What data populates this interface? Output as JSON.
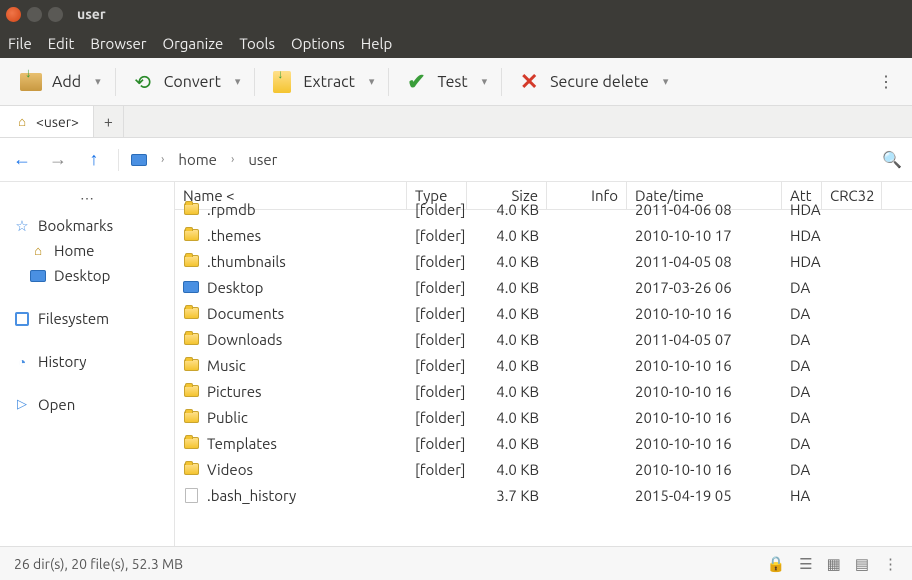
{
  "titlebar": {
    "title": "user"
  },
  "menubar": [
    "File",
    "Edit",
    "Browser",
    "Organize",
    "Tools",
    "Options",
    "Help"
  ],
  "toolbar": {
    "add": "Add",
    "convert": "Convert",
    "extract": "Extract",
    "test": "Test",
    "secure_delete": "Secure delete"
  },
  "tab": {
    "label": "<user>"
  },
  "breadcrumb": [
    "home",
    "user"
  ],
  "sidebar": {
    "bookmarks": "Bookmarks",
    "home": "Home",
    "desktop": "Desktop",
    "filesystem": "Filesystem",
    "history": "History",
    "open": "Open"
  },
  "columns": {
    "name": "Name <",
    "type": "Type",
    "size": "Size",
    "info": "Info",
    "date": "Date/time",
    "attr": "Att",
    "crc": "CRC32"
  },
  "files": [
    {
      "icon": "folder",
      "name": ".rpmdb",
      "type": "[folder]",
      "size": "4.0 KB",
      "date": "2011-04-06 08",
      "attr": "HDA"
    },
    {
      "icon": "folder",
      "name": ".themes",
      "type": "[folder]",
      "size": "4.0 KB",
      "date": "2010-10-10 17",
      "attr": "HDA"
    },
    {
      "icon": "folder",
      "name": ".thumbnails",
      "type": "[folder]",
      "size": "4.0 KB",
      "date": "2011-04-05 08",
      "attr": "HDA"
    },
    {
      "icon": "desktop",
      "name": "Desktop",
      "type": "[folder]",
      "size": "4.0 KB",
      "date": "2017-03-26 06",
      "attr": "DA"
    },
    {
      "icon": "folder",
      "name": "Documents",
      "type": "[folder]",
      "size": "4.0 KB",
      "date": "2010-10-10 16",
      "attr": "DA"
    },
    {
      "icon": "folder",
      "name": "Downloads",
      "type": "[folder]",
      "size": "4.0 KB",
      "date": "2011-04-05 07",
      "attr": "DA"
    },
    {
      "icon": "folder",
      "name": "Music",
      "type": "[folder]",
      "size": "4.0 KB",
      "date": "2010-10-10 16",
      "attr": "DA"
    },
    {
      "icon": "folder",
      "name": "Pictures",
      "type": "[folder]",
      "size": "4.0 KB",
      "date": "2010-10-10 16",
      "attr": "DA"
    },
    {
      "icon": "folder",
      "name": "Public",
      "type": "[folder]",
      "size": "4.0 KB",
      "date": "2010-10-10 16",
      "attr": "DA"
    },
    {
      "icon": "folder",
      "name": "Templates",
      "type": "[folder]",
      "size": "4.0 KB",
      "date": "2010-10-10 16",
      "attr": "DA"
    },
    {
      "icon": "folder",
      "name": "Videos",
      "type": "[folder]",
      "size": "4.0 KB",
      "date": "2010-10-10 16",
      "attr": "DA"
    },
    {
      "icon": "file",
      "name": ".bash_history",
      "type": "",
      "size": "3.7 KB",
      "date": "2015-04-19 05",
      "attr": "HA"
    }
  ],
  "status": {
    "text": "26 dir(s), 20 file(s), 52.3 MB"
  }
}
